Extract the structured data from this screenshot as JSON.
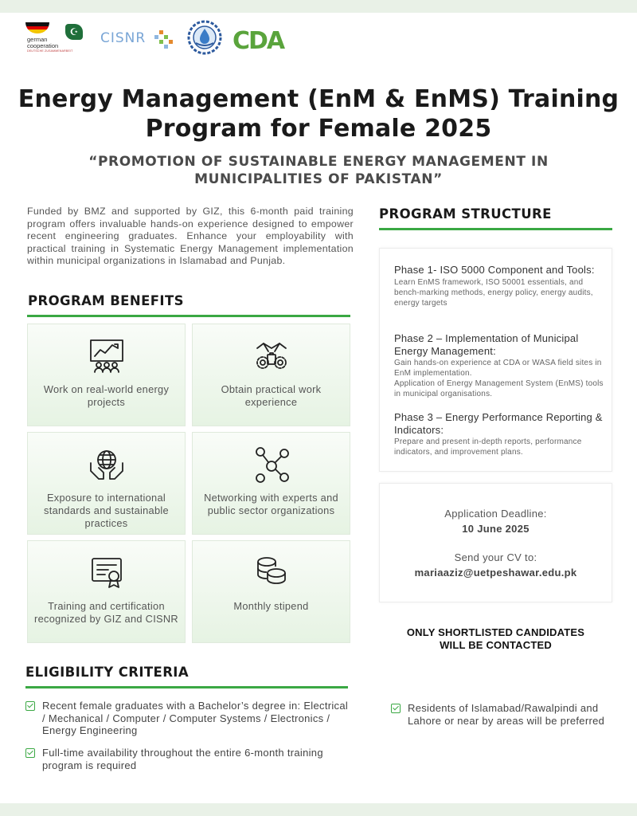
{
  "logos": {
    "german_cooperation": {
      "line1": "german",
      "line2": "cooperation",
      "line3": "DEUTSCHE ZUSAMMENARBEIT"
    },
    "cisnr": {
      "text": "CISNR"
    },
    "seal": {
      "icon": "wasa-seal-icon"
    },
    "cda": {
      "text": "CDA",
      "color": "#5aa43c"
    }
  },
  "title_line1": "Energy Management (EnM & EnMS) Training",
  "title_line2": "Program for Female 2025",
  "subtitle_line1": "“PROMOTION OF SUSTAINABLE ENERGY MANAGEMENT IN",
  "subtitle_line2": "MUNICIPALITIES OF PAKISTAN”",
  "intro": "Funded by BMZ and supported by GIZ, this 6-month paid training program offers invaluable hands-on experience designed to empower recent engineering graduates. Enhance your employability with practical training in Systematic Energy Management implementation within municipal organizations in Islamabad and Punjab.",
  "benefits": {
    "heading": "PROGRAM BENEFITS",
    "items": [
      {
        "label": "Work on real-world energy projects",
        "icon": "presentation-chart-icon"
      },
      {
        "label": "Obtain practical work experience",
        "icon": "handshake-gears-icon"
      },
      {
        "label": "Exposure to international standards and sustainable practices",
        "icon": "globe-hands-icon"
      },
      {
        "label": "Networking with experts and public sector organizations",
        "icon": "network-nodes-icon"
      },
      {
        "label": "Training and certification recognized by GIZ and CISNR",
        "icon": "certificate-icon"
      },
      {
        "label": "Monthly stipend",
        "icon": "coins-icon"
      }
    ]
  },
  "structure": {
    "heading": "PROGRAM STRUCTURE",
    "phases": [
      {
        "title": "Phase 1- ISO 5000 Component and Tools:",
        "desc": "Learn EnMS framework, ISO 50001 essentials, and bench-marking methods, energy policy, energy audits, energy targets"
      },
      {
        "title": "Phase 2 – Implementation of Municipal Energy Management:",
        "desc": "Gain hands-on experience at CDA or WASA field sites in EnM implementation.",
        "desc2": "Application of Energy Management System (EnMS) tools in municipal organisations."
      },
      {
        "title": "Phase 3 – Energy Performance Reporting & Indicators:",
        "desc": "Prepare and present in-depth reports, performance indicators, and improvement plans."
      }
    ]
  },
  "application": {
    "deadline_label": "Application Deadline:",
    "deadline": "10 June 2025",
    "cv_label": "Send your CV to:",
    "email": "mariaaziz@uetpeshawar.edu.pk"
  },
  "shortlist_line1": "ONLY SHORTLISTED CANDIDATES",
  "shortlist_line2": "WILL BE CONTACTED",
  "eligibility": {
    "heading": "ELIGIBILITY CRITERIA",
    "items": [
      "Recent female graduates with a Bachelor’s degree in: Electrical / Mechanical / Computer / Computer Systems / Electronics / Energy Engineering",
      "Full-time availability throughout the entire 6-month training program is required",
      "Residents of Islamabad/Rawalpindi and Lahore or near by areas will be preferred"
    ]
  },
  "colors": {
    "accent": "#3aa843",
    "card_bg": "#eaf5e7",
    "band": "#e9f1e7"
  }
}
